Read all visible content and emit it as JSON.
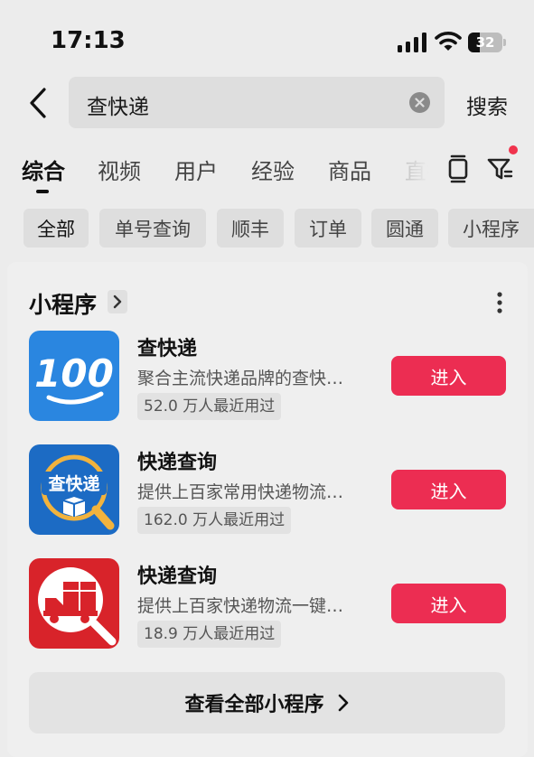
{
  "status_bar": {
    "time": "17:13",
    "battery": "32"
  },
  "search": {
    "query": "查快递",
    "button_label": "搜索"
  },
  "tabs": [
    {
      "label": "综合",
      "active": true
    },
    {
      "label": "视频"
    },
    {
      "label": "用户"
    },
    {
      "label": "经验"
    },
    {
      "label": "商品"
    },
    {
      "label": "直播"
    }
  ],
  "filter_chips": [
    {
      "label": "全部",
      "active": true
    },
    {
      "label": "单号查询"
    },
    {
      "label": "顺丰"
    },
    {
      "label": "订单"
    },
    {
      "label": "圆通"
    },
    {
      "label": "小程序"
    }
  ],
  "section": {
    "title": "小程序"
  },
  "apps": [
    {
      "name": "查快递",
      "description": "聚合主流快递品牌的查快…",
      "users": "52.0 万人最近用过",
      "button": "进入",
      "icon": "100-logo-icon",
      "icon_text": "100"
    },
    {
      "name": "快递查询",
      "description": "提供上百家常用快递物流…",
      "users": "162.0 万人最近用过",
      "button": "进入",
      "icon": "package-search-icon",
      "icon_text": "查快递"
    },
    {
      "name": "快递查询",
      "description": "提供上百家快递物流一键…",
      "users": "18.9 万人最近用过",
      "button": "进入",
      "icon": "truck-search-icon"
    }
  ],
  "view_all": {
    "label": "查看全部小程序"
  },
  "colors": {
    "accent": "#ec2d52",
    "notification_dot": "#f0334d",
    "app1_bg": "#2a86e0",
    "app2_bg": "#1c6bc4",
    "app3_bg": "#d8232a"
  }
}
